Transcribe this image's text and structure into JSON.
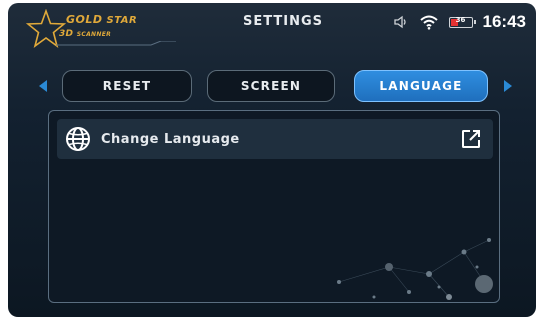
{
  "brand": {
    "line1_big": "GOLD",
    "line1_small": "STAR",
    "line2_big": "3D",
    "line2_small": "SCANNER"
  },
  "header": {
    "title": "SETTINGS",
    "time": "16:43",
    "battery_label": "36",
    "battery_level": 0.36,
    "icons": [
      "speaker-icon",
      "wifi-icon",
      "battery-icon"
    ]
  },
  "tabs": [
    {
      "label": "RESET",
      "active": false
    },
    {
      "label": "SCREEN",
      "active": false
    },
    {
      "label": "LANGUAGE",
      "active": true
    }
  ],
  "nav": {
    "prev_icon": "left-arrow-icon",
    "next_icon": "right-arrow-icon"
  },
  "panel": {
    "rows": [
      {
        "label": "Change Language",
        "icon": "globe-icon",
        "action_icon": "external-link-icon"
      }
    ]
  },
  "colors": {
    "accent": "#2a8ad6",
    "active_tab": "#2f8ee0",
    "brand_gold": "#e0a93a",
    "battery_low": "#e53232"
  }
}
